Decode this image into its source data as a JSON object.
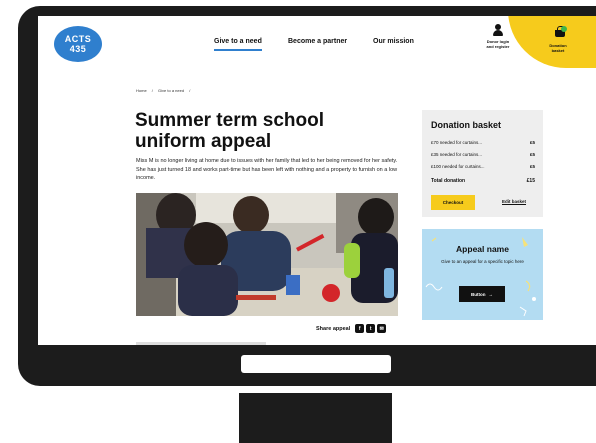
{
  "header": {
    "logo": {
      "line1": "ACTS",
      "line2": "435"
    },
    "nav": [
      {
        "label": "Give to a need",
        "active": true
      },
      {
        "label": "Become a partner",
        "active": false
      },
      {
        "label": "Our mission",
        "active": false
      }
    ],
    "donor": {
      "line1": "Donor login",
      "line2": "and register",
      "icon": "person-icon"
    },
    "basket": {
      "line1": "Donation",
      "line2": "basket",
      "icon": "basket-icon"
    }
  },
  "breadcrumb": [
    "Home",
    "/",
    "Give to a need",
    "/"
  ],
  "appeal_page": {
    "title": "Summer term school uniform appeal",
    "description": "Miss M is no longer living at home due to issues with her family that led to her being removed for her safety. She has just turned 18 and works part-time but has been left with nothing and a property to furnish on a low income.",
    "share_label": "Share appeal",
    "share_icons": [
      "facebook-icon",
      "twitter-icon",
      "email-icon"
    ]
  },
  "donation_basket": {
    "title": "Donation basket",
    "items": [
      {
        "label": "£70 needed for curtains...",
        "amount": "£5"
      },
      {
        "label": "£35 needed for curtains...",
        "amount": "£5"
      },
      {
        "label": "£100 needed for curtains...",
        "amount": "£5"
      }
    ],
    "total_label": "Total donation",
    "total_amount": "£15",
    "checkout_label": "Checkout",
    "edit_label": "Edit basket"
  },
  "appeal_card": {
    "title": "Appeal name",
    "description": "Give to an appeal for a specific topic here",
    "button_label": "Button",
    "button_icon": "arrow-right-icon"
  },
  "colors": {
    "brand_blue": "#2f7fce",
    "accent_yellow": "#f6cb1c",
    "card_blue": "#b3dcf2",
    "frame": "#1c1c1c"
  }
}
